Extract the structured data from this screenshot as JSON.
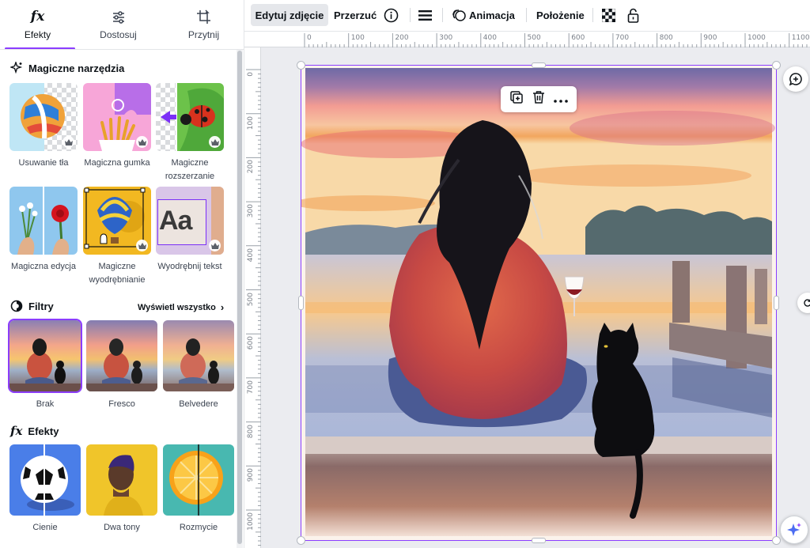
{
  "panel": {
    "tabs": [
      {
        "label": "Efekty",
        "icon": "fx-icon"
      },
      {
        "label": "Dostosuj",
        "icon": "sliders-icon"
      },
      {
        "label": "Przytnij",
        "icon": "crop-icon"
      }
    ],
    "magic": {
      "title": "Magiczne narzędzia",
      "items": [
        {
          "label": "Usuwanie tła"
        },
        {
          "label": "Magiczna gumka"
        },
        {
          "label": "Magiczne rozszerzanie"
        },
        {
          "label": "Magiczna edycja"
        },
        {
          "label": "Magiczne wyodrębnianie"
        },
        {
          "label": "Wyodrębnij tekst",
          "thumb_text": "Aa"
        }
      ]
    },
    "filters": {
      "title": "Filtry",
      "view_all": "Wyświetl wszystko",
      "items": [
        {
          "label": "Brak",
          "selected": true
        },
        {
          "label": "Fresco",
          "selected": false
        },
        {
          "label": "Belvedere",
          "selected": false
        }
      ]
    },
    "effects": {
      "title": "Efekty",
      "items": [
        {
          "label": "Cienie"
        },
        {
          "label": "Dwa tony"
        },
        {
          "label": "Rozmycie"
        }
      ]
    }
  },
  "toolbar": {
    "edit_photo": "Edytuj zdjęcie",
    "flip": "Przerzuć",
    "animation": "Animacja",
    "position": "Położenie"
  },
  "rulers": {
    "horizontal": [
      "0",
      "100",
      "200",
      "300",
      "400",
      "500",
      "600",
      "700",
      "800",
      "900",
      "1000",
      "1100"
    ],
    "vertical": [
      "0",
      "100",
      "200",
      "300",
      "400",
      "500",
      "600",
      "700",
      "800",
      "900",
      "1000"
    ]
  },
  "colors": {
    "accent": "#8b3dff"
  }
}
